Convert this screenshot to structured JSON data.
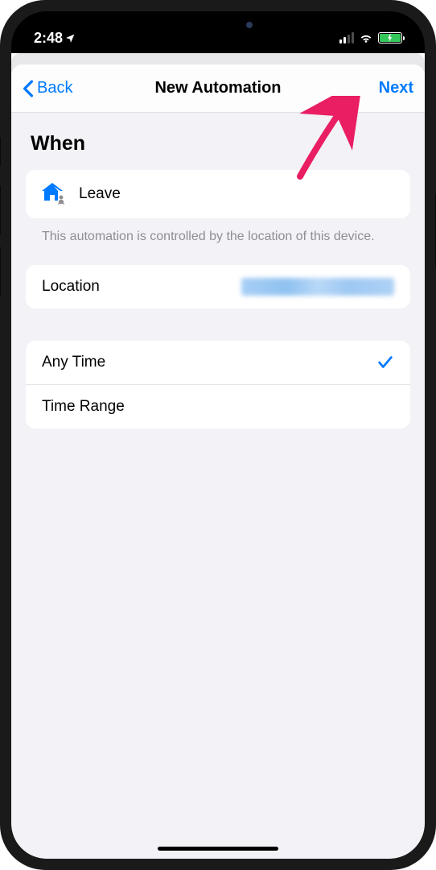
{
  "statusBar": {
    "time": "2:48"
  },
  "nav": {
    "back": "Back",
    "title": "New Automation",
    "next": "Next"
  },
  "sectionHeader": "When",
  "triggerRow": {
    "label": "Leave"
  },
  "footerNote": "This automation is controlled by the location of this device.",
  "locationRow": {
    "label": "Location"
  },
  "timeOptions": {
    "anyTime": "Any Time",
    "timeRange": "Time Range",
    "selected": "anyTime"
  }
}
